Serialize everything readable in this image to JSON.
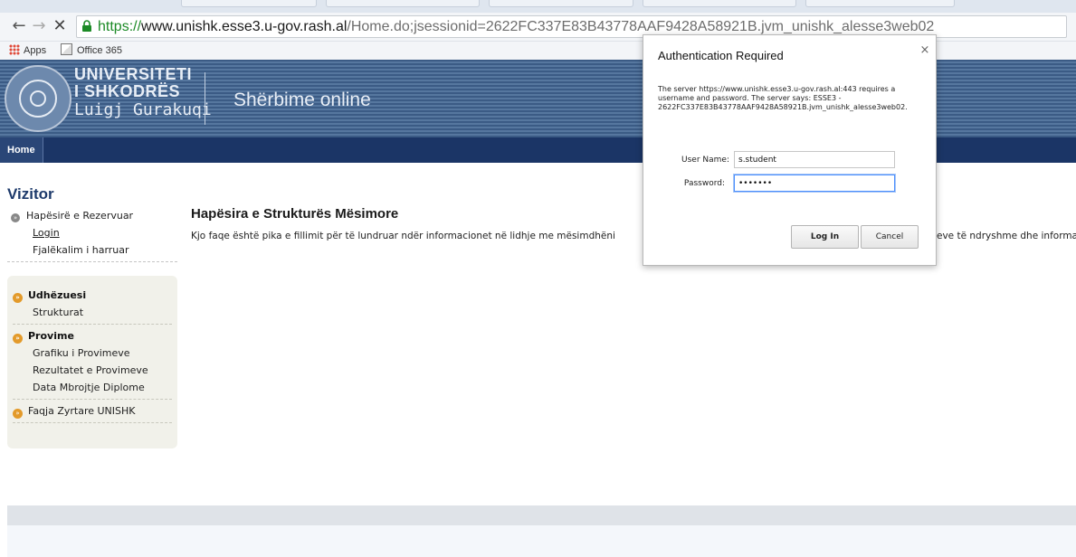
{
  "browser": {
    "url_scheme": "https://",
    "url_host": "www.unishk.esse3.u-gov.rash.al",
    "url_path": "/Home.do;jsessionid=2622FC337E83B43778AAF9428A58921B.jvm_unishk_alesse3web02",
    "bookmarks": [
      {
        "label": "Apps",
        "icon": "apps-grid-icon"
      },
      {
        "label": "Office 365",
        "icon": "office365-icon"
      }
    ]
  },
  "header": {
    "university_line1": "UNIVERSITETI",
    "university_line2": "I SHKODRËS",
    "university_line3": "Luigj Gurakuqi",
    "service_title": "Shërbime online"
  },
  "navbar": {
    "home_label": "Home"
  },
  "sidebar": {
    "section_title": "Vizitor",
    "reserved_area": "Hapësirë e Rezervuar",
    "login": "Login",
    "forgot_password": "Fjalëkalim i harruar",
    "guide_title": "Udhëzuesi",
    "guide_items": [
      "Strukturat"
    ],
    "exams_title": "Provime",
    "exam_items": [
      "Grafiku i Provimeve",
      "Rezultatet e Provimeve",
      "Data Mbrojtje Diplome"
    ],
    "official_page": "Faqja Zyrtare UNISHK"
  },
  "main": {
    "title": "Hapësira e Strukturës Mësimore",
    "intro": "Kjo faqe është pika e fillimit për të lundruar ndër informacionet në lidhje me mësimdhëni",
    "intro_tail": "eve të ndryshme dhe informa"
  },
  "dialog": {
    "title": "Authentication Required",
    "message": "The server https://www.unishk.esse3.u-gov.rash.al:443 requires a username and password. The server says: ESSE3 - 2622FC337E83B43778AAF9428A58921B.jvm_unishk_alesse3web02.",
    "username_label": "User Name:",
    "username_value": "s.student",
    "password_label": "Password:",
    "password_value": "•••••••",
    "login_button": "Log In",
    "cancel_button": "Cancel"
  }
}
